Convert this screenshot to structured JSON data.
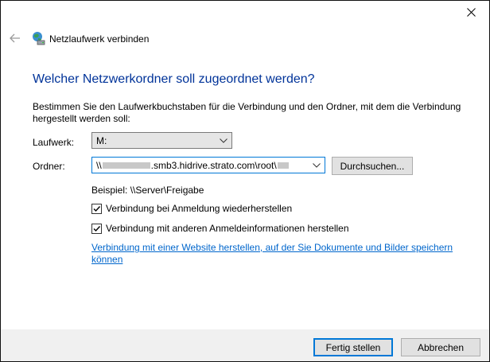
{
  "window": {
    "close_icon": "close-icon"
  },
  "wizard": {
    "back_icon": "arrow-left-icon",
    "app_icon": "network-drive-icon",
    "title": "Netzlaufwerk verbinden"
  },
  "heading": "Welcher Netzwerkordner soll zugeordnet werden?",
  "description": "Bestimmen Sie den Laufwerkbuchstaben für die Verbindung und den Ordner, mit dem die Verbindung hergestellt werden soll:",
  "drive": {
    "label": "Laufwerk:",
    "value": "M:"
  },
  "folder": {
    "label": "Ordner:",
    "value_prefix": "\\\\",
    "value_main": ".smb3.hidrive.strato.com\\root\\",
    "browse_label": "Durchsuchen..."
  },
  "example": "Beispiel: \\\\Server\\Freigabe",
  "options": {
    "reconnect": {
      "label": "Verbindung bei Anmeldung wiederherstellen",
      "checked": true
    },
    "other_credentials": {
      "label": "Verbindung mit anderen Anmeldeinformationen herstellen",
      "checked": true
    }
  },
  "website_link": "Verbindung mit einer Website herstellen, auf der Sie Dokumente und Bilder speichern können",
  "footer": {
    "finish_label": "Fertig stellen",
    "cancel_label": "Abbrechen"
  }
}
